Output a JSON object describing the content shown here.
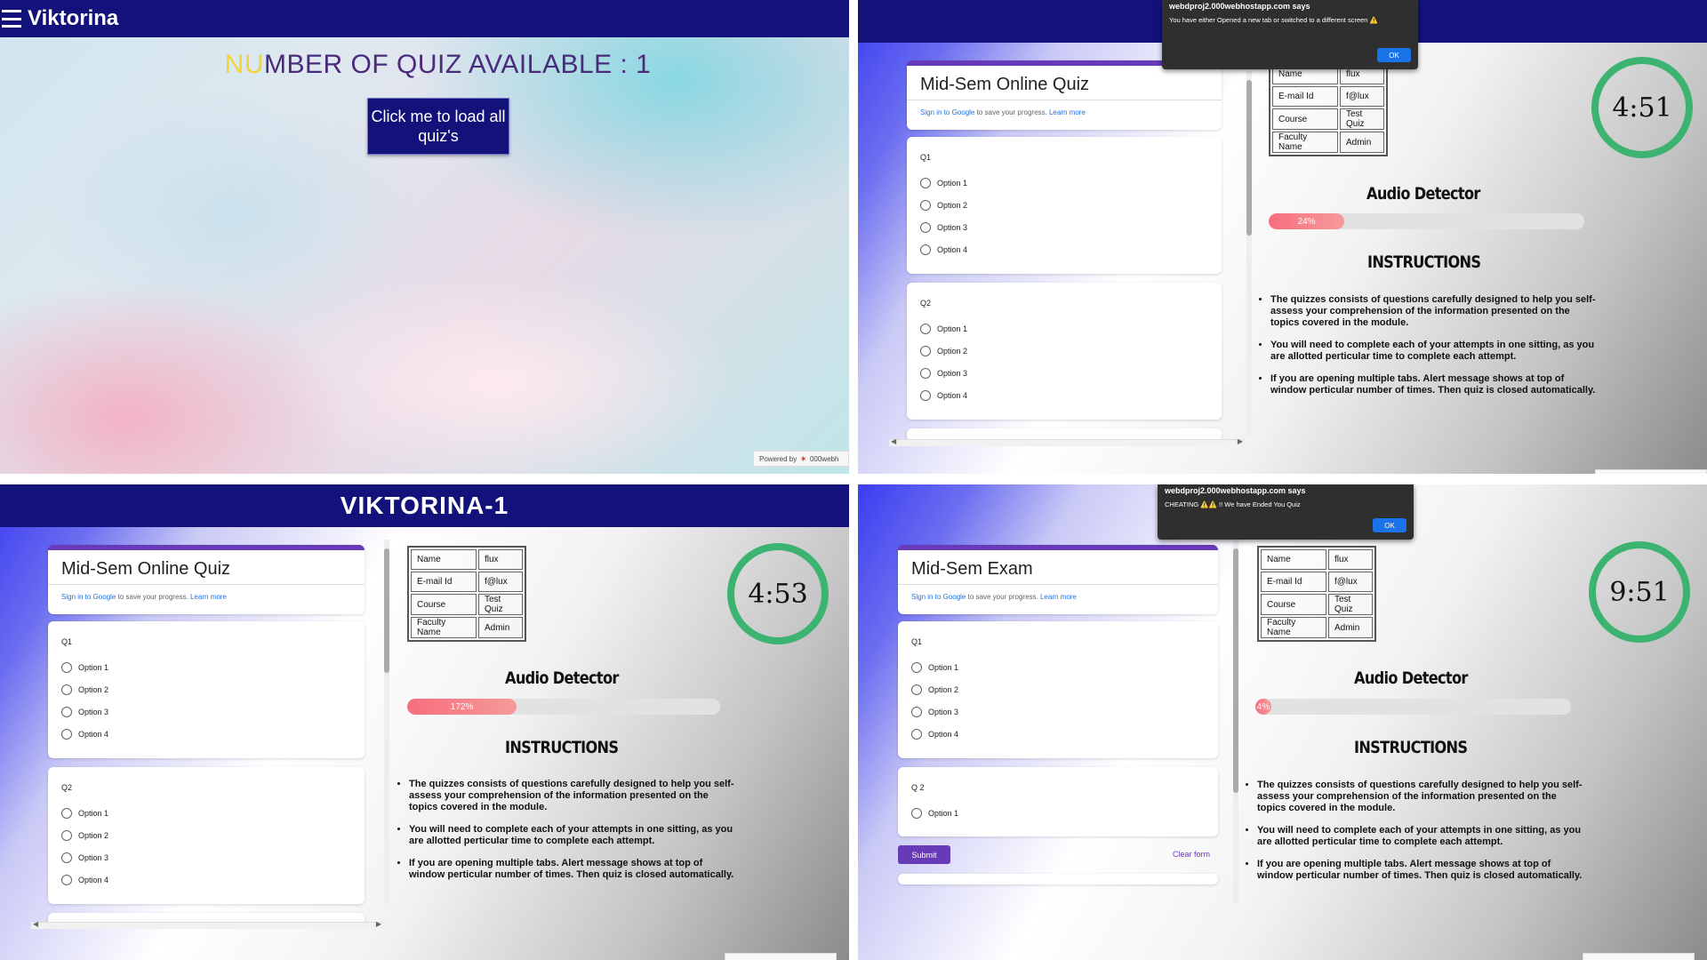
{
  "panel1": {
    "brand": "Viktorina",
    "count_highlight": "NU",
    "count_rest": "MBER OF QUIZ AVAILABLE : 1",
    "load_button": "Click me to load all quiz's",
    "powered_by": "Powered by",
    "powered_host": "000webh"
  },
  "panel2": {
    "dialog": {
      "site": "webdproj2.000webhostapp.com says",
      "message": "You have either Opened a new tab or switched to a different screen ⚠️",
      "ok": "OK"
    },
    "form_title": "Mid-Sem Online Quiz",
    "timer": "4:51",
    "meter_label": "24%",
    "meter_value": 24
  },
  "panel3": {
    "header": "VIKTORINA-1",
    "form_title": "Mid-Sem Online Quiz",
    "timer": "4:53",
    "meter_label": "172%",
    "meter_value": 35
  },
  "panel4": {
    "dialog": {
      "site": "webdproj2.000webhostapp.com says",
      "message": "CHEATING ⚠️⚠️ !! We have Ended You Quiz",
      "ok": "OK"
    },
    "form_title": "Mid-Sem Exam",
    "timer": "9:51",
    "meter_label": "4%",
    "meter_value": 4,
    "submit": "Submit",
    "clear": "Clear form",
    "q2_label": "Q 2"
  },
  "form": {
    "sign_in_link": "Sign in to Google",
    "sign_in_text": " to save your progress. ",
    "learn_more": "Learn more",
    "q1": "Q1",
    "q2": "Q2",
    "options": [
      "Option 1",
      "Option 2",
      "Option 3",
      "Option 4"
    ]
  },
  "info_table": [
    {
      "key": "Name",
      "value": "flux"
    },
    {
      "key": "E-mail Id",
      "value": "f@lux"
    },
    {
      "key": "Course",
      "value": "Test Quiz"
    },
    {
      "key": "Faculty Name",
      "value": "Admin"
    }
  ],
  "audio_heading": "Audio Detector",
  "instructions_heading": "INSTRUCTIONS",
  "instructions": [
    "The quizzes consists of questions carefully designed to help you self-assess your comprehension of the information presented on the topics covered in the module.",
    "You will need to complete each of your attempts in one sitting, as you are allotted perticular time to complete each attempt.",
    "If you are opening multiple tabs. Alert message shows at top of window perticular number of times. Then quiz is closed automatically."
  ],
  "colors": {
    "navy": "#13127a",
    "timer_ring": "#3cb371",
    "meter_fill": "#f66e7e",
    "form_accent": "#673ab7"
  }
}
